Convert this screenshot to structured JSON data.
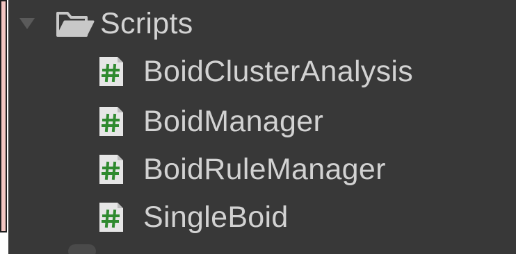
{
  "tree": {
    "folder": {
      "label": "Scripts",
      "icon": "folder-open-icon",
      "expanded": true,
      "foldout_icon": "triangle-down-icon"
    },
    "items": [
      {
        "label": "BoidClusterAnalysis",
        "icon": "csharp-script-icon"
      },
      {
        "label": "BoidManager",
        "icon": "csharp-script-icon"
      },
      {
        "label": "BoidRuleManager",
        "icon": "csharp-script-icon"
      },
      {
        "label": "SingleBoid",
        "icon": "csharp-script-icon"
      }
    ]
  },
  "colors": {
    "panel_background": "#383838",
    "text": "#d2d2d2",
    "script_icon_page": "#e6e6e6",
    "script_icon_hash": "#2f8a2f",
    "left_strip": "#f3c6c2"
  }
}
